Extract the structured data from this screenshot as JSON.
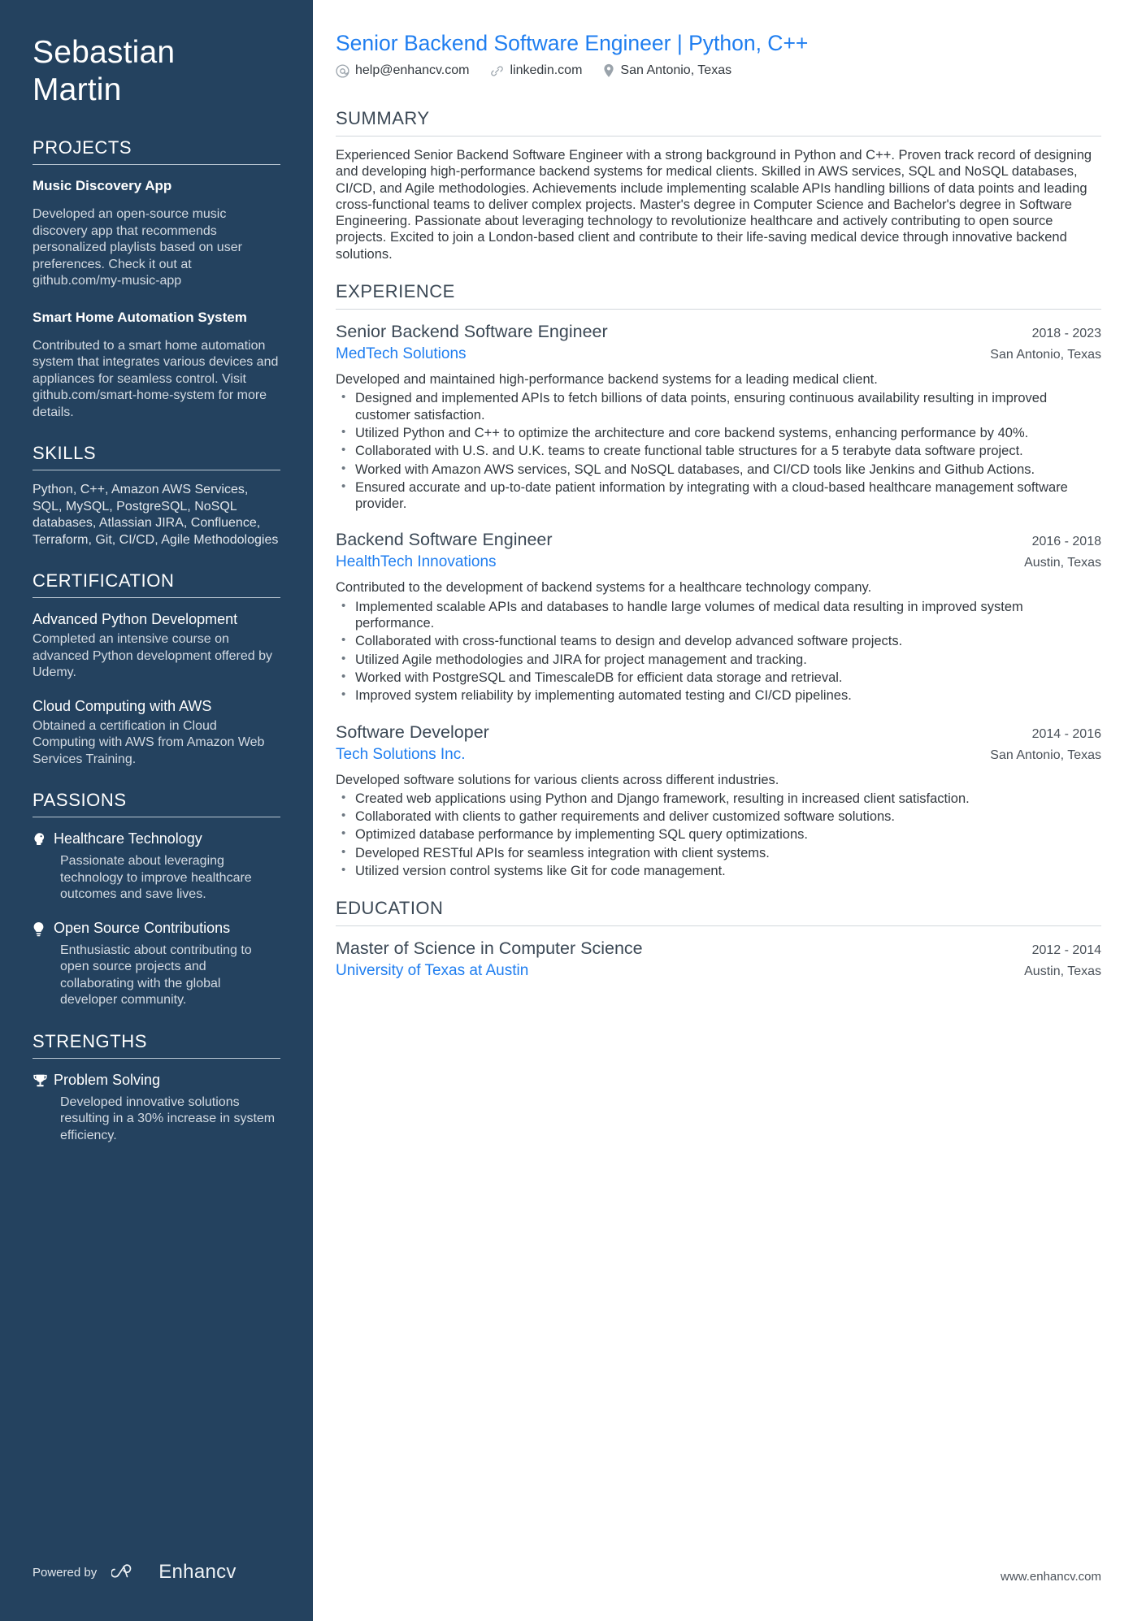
{
  "sidebar": {
    "name_first": "Sebastian",
    "name_last": "Martin",
    "projects": {
      "heading": "PROJECTS",
      "items": [
        {
          "title": "Music Discovery App",
          "body": "Developed an open-source music discovery app that recommends personalized playlists based on user preferences. Check it out at github.com/my-music-app"
        },
        {
          "title": "Smart Home Automation System",
          "body": "Contributed to a smart home automation system that integrates various devices and appliances for seamless control. Visit github.com/smart-home-system for more details."
        }
      ]
    },
    "skills": {
      "heading": "SKILLS",
      "text": "Python, C++, Amazon AWS Services, SQL, MySQL, PostgreSQL, NoSQL databases, Atlassian JIRA, Confluence, Terraform, Git, CI/CD, Agile Methodologies"
    },
    "certification": {
      "heading": "CERTIFICATION",
      "items": [
        {
          "title": "Advanced Python Development",
          "body": "Completed an intensive course on advanced Python development offered by Udemy."
        },
        {
          "title": "Cloud Computing with AWS",
          "body": "Obtained a certification in Cloud Computing with AWS from Amazon Web Services Training."
        }
      ]
    },
    "passions": {
      "heading": "PASSIONS",
      "items": [
        {
          "icon": "head-brain-icon",
          "title": "Healthcare Technology",
          "body": "Passionate about leveraging technology to improve healthcare outcomes and save lives."
        },
        {
          "icon": "lightbulb-icon",
          "title": "Open Source Contributions",
          "body": "Enthusiastic about contributing to open source projects and collaborating with the global developer community."
        }
      ]
    },
    "strengths": {
      "heading": "STRENGTHS",
      "items": [
        {
          "icon": "trophy-icon",
          "title": "Problem Solving",
          "body": "Developed innovative solutions resulting in a 30% increase in system efficiency."
        }
      ]
    },
    "footer": {
      "powered_by": "Powered by",
      "brand": "Enhancv"
    }
  },
  "main": {
    "headline": "Senior Backend Software Engineer | Python, C++",
    "contacts": [
      {
        "icon": "at-email-icon",
        "text": "help@enhancv.com"
      },
      {
        "icon": "link-icon",
        "text": "linkedin.com"
      },
      {
        "icon": "location-pin-icon",
        "text": "San Antonio, Texas"
      }
    ],
    "summary": {
      "heading": "SUMMARY",
      "text": "Experienced Senior Backend Software Engineer with a strong background in Python and C++. Proven track record of designing and developing high-performance backend systems for medical clients. Skilled in AWS services, SQL and NoSQL databases, CI/CD, and Agile methodologies. Achievements include implementing scalable APIs handling billions of data points and leading cross-functional teams to deliver complex projects. Master's degree in Computer Science and Bachelor's degree in Software Engineering. Passionate about leveraging technology to revolutionize healthcare and actively contributing to open source projects. Excited to join a London-based client and contribute to their life-saving medical device through innovative backend solutions."
    },
    "experience": {
      "heading": "EXPERIENCE",
      "entries": [
        {
          "role": "Senior Backend Software Engineer",
          "dates": "2018 - 2023",
          "org": "MedTech Solutions",
          "location": "San Antonio, Texas",
          "desc": "Developed and maintained high-performance backend systems for a leading medical client.",
          "bullets": [
            "Designed and implemented APIs to fetch billions of data points, ensuring continuous availability resulting in improved customer satisfaction.",
            "Utilized Python and C++ to optimize the architecture and core backend systems, enhancing performance by 40%.",
            "Collaborated with U.S. and U.K. teams to create functional table structures for a 5 terabyte data software project.",
            "Worked with Amazon AWS services, SQL and NoSQL databases, and CI/CD tools like Jenkins and Github Actions.",
            "Ensured accurate and up-to-date patient information by integrating with a cloud-based healthcare management software provider."
          ]
        },
        {
          "role": "Backend Software Engineer",
          "dates": "2016 - 2018",
          "org": "HealthTech Innovations",
          "location": "Austin, Texas",
          "desc": "Contributed to the development of backend systems for a healthcare technology company.",
          "bullets": [
            "Implemented scalable APIs and databases to handle large volumes of medical data resulting in improved system performance.",
            "Collaborated with cross-functional teams to design and develop advanced software projects.",
            "Utilized Agile methodologies and JIRA for project management and tracking.",
            "Worked with PostgreSQL and TimescaleDB for efficient data storage and retrieval.",
            "Improved system reliability by implementing automated testing and CI/CD pipelines."
          ]
        },
        {
          "role": "Software Developer",
          "dates": "2014 - 2016",
          "org": "Tech Solutions Inc.",
          "location": "San Antonio, Texas",
          "desc": "Developed software solutions for various clients across different industries.",
          "bullets": [
            "Created web applications using Python and Django framework, resulting in increased client satisfaction.",
            "Collaborated with clients to gather requirements and deliver customized software solutions.",
            "Optimized database performance by implementing SQL query optimizations.",
            "Developed RESTful APIs for seamless integration with client systems.",
            "Utilized version control systems like Git for code management."
          ]
        }
      ]
    },
    "education": {
      "heading": "EDUCATION",
      "entries": [
        {
          "degree": "Master of Science in Computer Science",
          "dates": "2012 - 2014",
          "school": "University of Texas at Austin",
          "location": "Austin, Texas"
        }
      ]
    },
    "footer_url": "www.enhancv.com"
  },
  "colors": {
    "sidebar_bg": "#24425f",
    "top_strip": "#1b2b3c",
    "accent_blue": "#1f7ef0",
    "body_text": "#33393f"
  }
}
